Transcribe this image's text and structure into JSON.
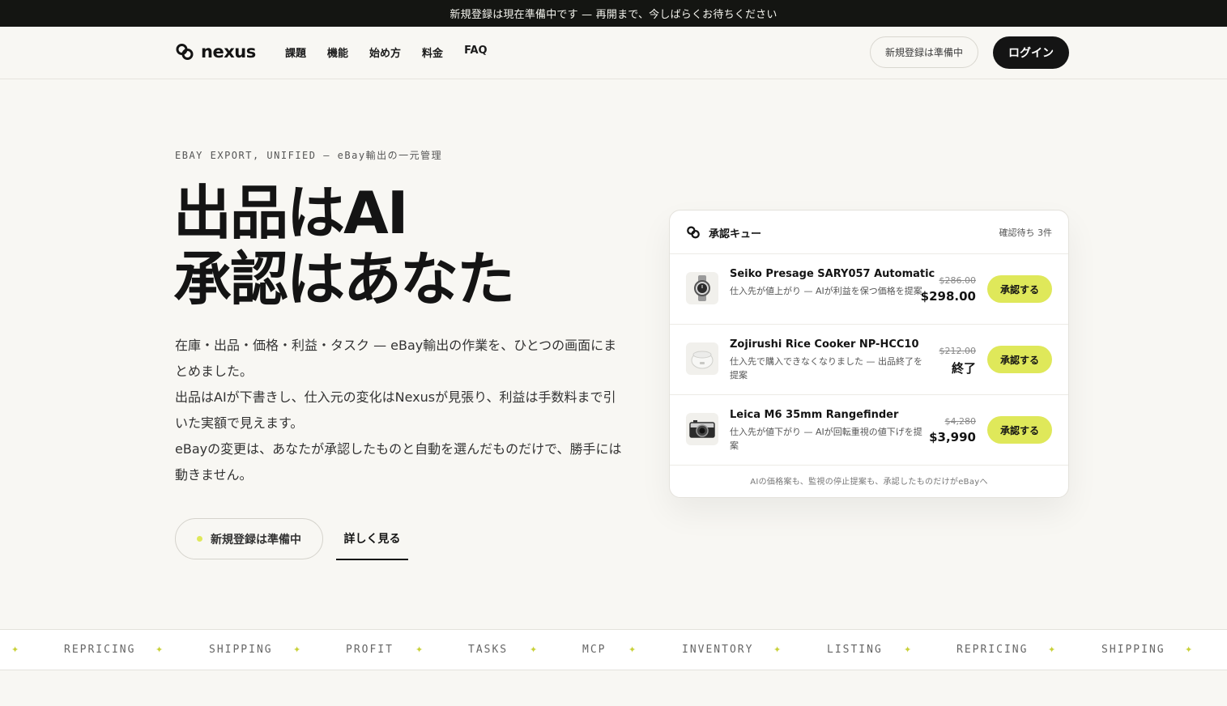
{
  "announcement": "新規登録は現在準備中です — 再開まで、今しばらくお待ちください",
  "brand": {
    "name": "nexus",
    "accent": "#dfe85a",
    "dark": "#141414"
  },
  "nav": {
    "links": [
      "課題",
      "機能",
      "始め方",
      "料金",
      "FAQ"
    ],
    "signup_label": "新規登録は準備中",
    "login_label": "ログイン"
  },
  "hero": {
    "eyebrow": "EBAY EXPORT, UNIFIED — eBay輸出の一元管理",
    "headline_line1": "出品はAI",
    "headline_line2": "承認はあなた",
    "lead": [
      "在庫・出品・価格・利益・タスク — eBay輸出の作業を、ひとつの画面にまとめました。",
      "出品はAIが下書きし、仕入元の変化はNexusが見張り、利益は手数料まで引いた実額で見えます。",
      "eBayの変更は、あなたが承認したものと自動を選んだものだけで、勝手には動きません。"
    ],
    "cta_primary": "新規登録は準備中",
    "cta_secondary": "詳しく見る"
  },
  "queue": {
    "title": "承認キュー",
    "pending": "確認待ち 3件",
    "approve_label": "承認する",
    "items": [
      {
        "name": "Seiko Presage SARY057 Automatic",
        "desc": "仕入先が値上がり — AIが利益を保つ価格を提案",
        "old_price": "$286.00",
        "new_price": "$298.00",
        "icon": "watch-icon"
      },
      {
        "name": "Zojirushi Rice Cooker NP-HCC10",
        "desc": "仕入先で購入できなくなりました — 出品終了を提案",
        "old_price": "$212.00",
        "new_price": "終了",
        "icon": "rice-cooker-icon"
      },
      {
        "name": "Leica M6 35mm Rangefinder",
        "desc": "仕入先が値下がり — AIが回転重視の値下げを提案",
        "old_price": "$4,280",
        "new_price": "$3,990",
        "icon": "camera-icon"
      }
    ],
    "footer": "AIの価格案も、監視の停止提案も、承認したものだけがeBayへ"
  },
  "ticker": [
    "REPRICING",
    "SHIPPING",
    "PROFIT",
    "TASKS",
    "MCP",
    "INVENTORY",
    "LISTING",
    "REPRICING",
    "SHIPPING"
  ]
}
